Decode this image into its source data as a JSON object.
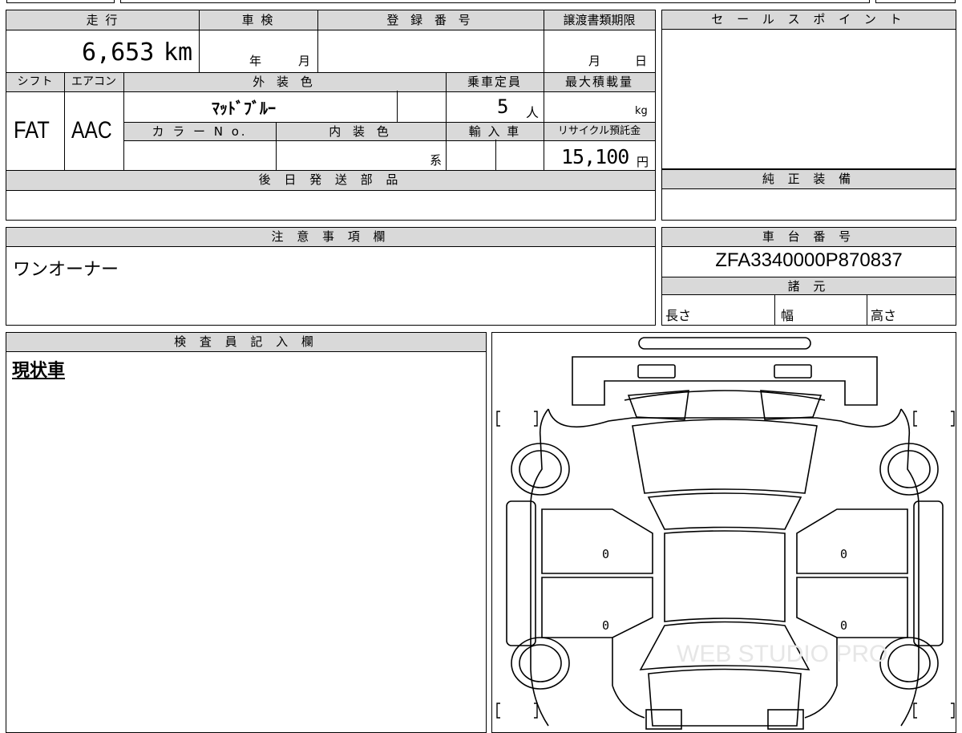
{
  "main": {
    "labels": {
      "mileage": "走 行",
      "inspection": "車 検",
      "registration": "登 録 番 号",
      "transfer_deadline": "譲渡書類期限",
      "shift": "シフト",
      "aircon": "エアコン",
      "exterior_color": "外 装 色",
      "capacity": "乗車定員",
      "max_load": "最大積載量",
      "color_no": "カ ラ ー N o.",
      "interior_color": "内 装 色",
      "import": "輸 入 車",
      "recycle_fee": "リサイクル預託金",
      "later_parts": "後 日 発 送 部 品"
    },
    "values": {
      "mileage": "6,653",
      "mileage_unit": "km",
      "year_label": "年",
      "month_label": "月",
      "deadline_month": "月",
      "deadline_day": "日",
      "shift": "FAT",
      "aircon": "AAC",
      "exterior_color": "ﾏｯﾄﾞﾌﾞﾙｰ",
      "capacity": "5",
      "capacity_unit": "人",
      "load_unit": "kg",
      "interior_suffix": "系",
      "recycle_fee": "15,100",
      "recycle_unit": "円"
    }
  },
  "sales_points": {
    "title": "セ ー ル ス ポ イ ン ト"
  },
  "genuine_equipment": {
    "title": "純 正 装 備"
  },
  "notes": {
    "title": "注 意 事 項 欄",
    "text": "ワンオーナー"
  },
  "chassis": {
    "title": "車 台 番 号",
    "number": "ZFA3340000P870837",
    "spec_title": "諸 元",
    "length": "長さ",
    "width": "幅",
    "height": "高さ"
  },
  "inspector": {
    "title": "検 査 員 記 入 欄",
    "text": "現状車"
  },
  "diagram": {
    "marks": [
      "0",
      "0",
      "0",
      "0"
    ],
    "watermark": "WEB STUDIO PRO"
  }
}
